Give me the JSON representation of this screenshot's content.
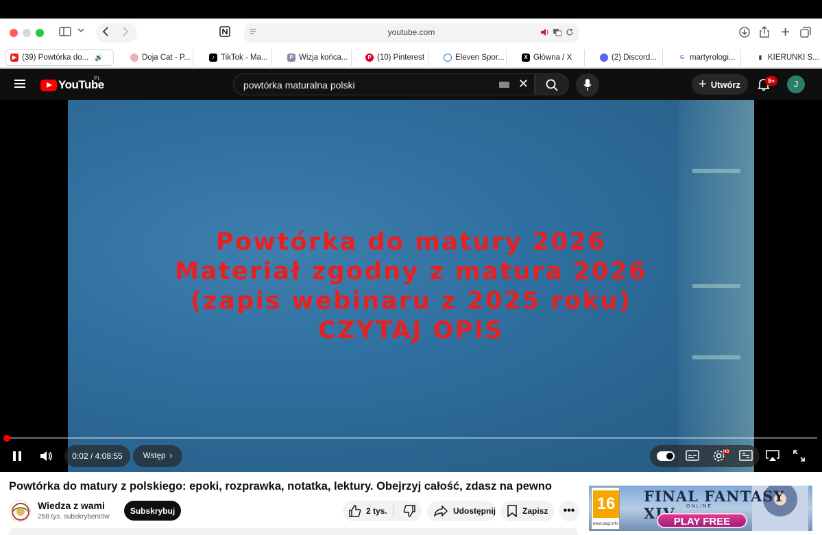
{
  "browser": {
    "url": "youtube.com",
    "tabs": [
      {
        "label": "(39) Powtórka do...",
        "color": "#e62117",
        "active": true,
        "audio": true
      },
      {
        "label": "Doja Cat - P...",
        "color": "#e8a0a0",
        "active": false
      },
      {
        "label": "TikTok - Ma...",
        "color": "#000000",
        "active": false
      },
      {
        "label": "Wizja końca...",
        "color": "#7a7a9a",
        "active": false
      },
      {
        "label": "(10) Pinterest",
        "color": "#e60023",
        "active": false
      },
      {
        "label": "Eleven Spor...",
        "color": "#3a6fd8",
        "active": false
      },
      {
        "label": "Główna / X",
        "color": "#000000",
        "active": false
      },
      {
        "label": "(2) Discord...",
        "color": "#5865f2",
        "active": false
      },
      {
        "label": "martyrologi...",
        "color": "#4285f4",
        "active": false
      },
      {
        "label": "KIERUNKI S...",
        "color": "#333333",
        "active": false
      }
    ]
  },
  "youtube": {
    "logo_text": "YouTube",
    "country_code": "PL",
    "search_query": "powtórka maturalna polski",
    "create_label": "Utwórz",
    "notification_badge": "9+",
    "avatar_letter": "J"
  },
  "player": {
    "overlay_lines": [
      "Powtórka do matury 2026",
      "Materiał zgodny z matura 2026",
      "(zapis webinaru z 2025 roku)",
      "CZYTAJ OPIS"
    ],
    "current_time": "0:02",
    "duration": "4:08:55",
    "time_display": "0:02 / 4:08:55",
    "chapter_label": "Wstęp",
    "progress_fraction": 0.005,
    "hd_badge": "HD"
  },
  "video": {
    "title": "Powtórka do matury z polskiego: epoki, rozprawka, notatka, lektury. Obejrzyj całość, zdasz na pewno",
    "channel_name": "Wiedza z wami",
    "subscribers": "258 tys. subskrybentów",
    "subscribe_label": "Subskrybuj",
    "likes": "2 tys.",
    "share_label": "Udostępnij",
    "save_label": "Zapisz"
  },
  "ad": {
    "pegi_rating": "16",
    "pegi_site": "www.pegi.info",
    "title": "FINAL FANTASY XIV",
    "subtitle": "ONLINE",
    "cta": "PLAY FREE"
  }
}
